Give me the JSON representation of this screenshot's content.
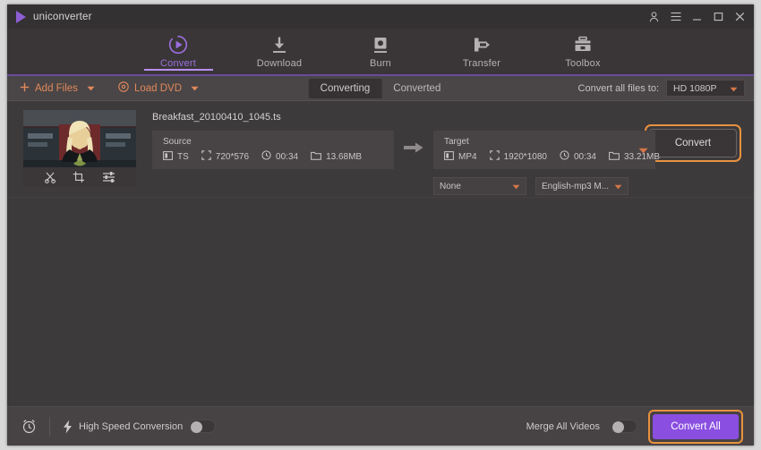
{
  "window": {
    "app_name": "uniconverter",
    "controls": [
      {
        "name": "account-icon",
        "glyph": "person"
      },
      {
        "name": "menu-icon",
        "glyph": "hamburger"
      },
      {
        "name": "minimize-button",
        "glyph": "minimize"
      },
      {
        "name": "maximize-button",
        "glyph": "maximize"
      },
      {
        "name": "close-button",
        "glyph": "close"
      }
    ]
  },
  "nav": {
    "active": "Convert",
    "accent": "#9b6fe0",
    "underline_color": "#b98ff0",
    "items": [
      {
        "label": "Convert",
        "icon": "convert-play-circle-icon"
      },
      {
        "label": "Download",
        "icon": "download-arrow-icon"
      },
      {
        "label": "Burn",
        "icon": "burn-disc-icon"
      },
      {
        "label": "Transfer",
        "icon": "transfer-device-icon"
      },
      {
        "label": "Toolbox",
        "icon": "toolbox-icon"
      }
    ]
  },
  "toolbar": {
    "add_files_label": "Add Files",
    "load_dvd_label": "Load DVD",
    "accent": "#e08a5c",
    "tabs": [
      {
        "label": "Converting",
        "active": true
      },
      {
        "label": "Converted",
        "active": false
      }
    ],
    "convert_all_to_label": "Convert all files to:",
    "convert_all_to_value": "HD 1080P"
  },
  "file": {
    "name": "Breakfast_20100410_1045.ts",
    "thumb_tools": [
      {
        "name": "trim-icon",
        "label": "Trim"
      },
      {
        "name": "crop-icon",
        "label": "Crop"
      },
      {
        "name": "effect-icon",
        "label": "Effect"
      }
    ],
    "source": {
      "title": "Source",
      "format": "TS",
      "resolution": "720*576",
      "duration": "00:34",
      "size": "13.68MB"
    },
    "target": {
      "title": "Target",
      "format": "MP4",
      "resolution": "1920*1080",
      "duration": "00:34",
      "size": "33.21MB"
    },
    "subtitle_select": "None",
    "audio_select": "English-mp3 M...",
    "convert_button": "Convert",
    "convert_highlight_color": "#e8923f"
  },
  "bottom": {
    "timer_icon": "alarm-clock-icon",
    "speed_icon": "lightning-bolt-icon",
    "high_speed_label": "High Speed Conversion",
    "high_speed_on": false,
    "merge_label": "Merge All Videos",
    "merge_on": false,
    "convert_all_label": "Convert All",
    "convert_all_color": "#8a4fe0",
    "convert_all_highlight_color": "#e8923f"
  }
}
